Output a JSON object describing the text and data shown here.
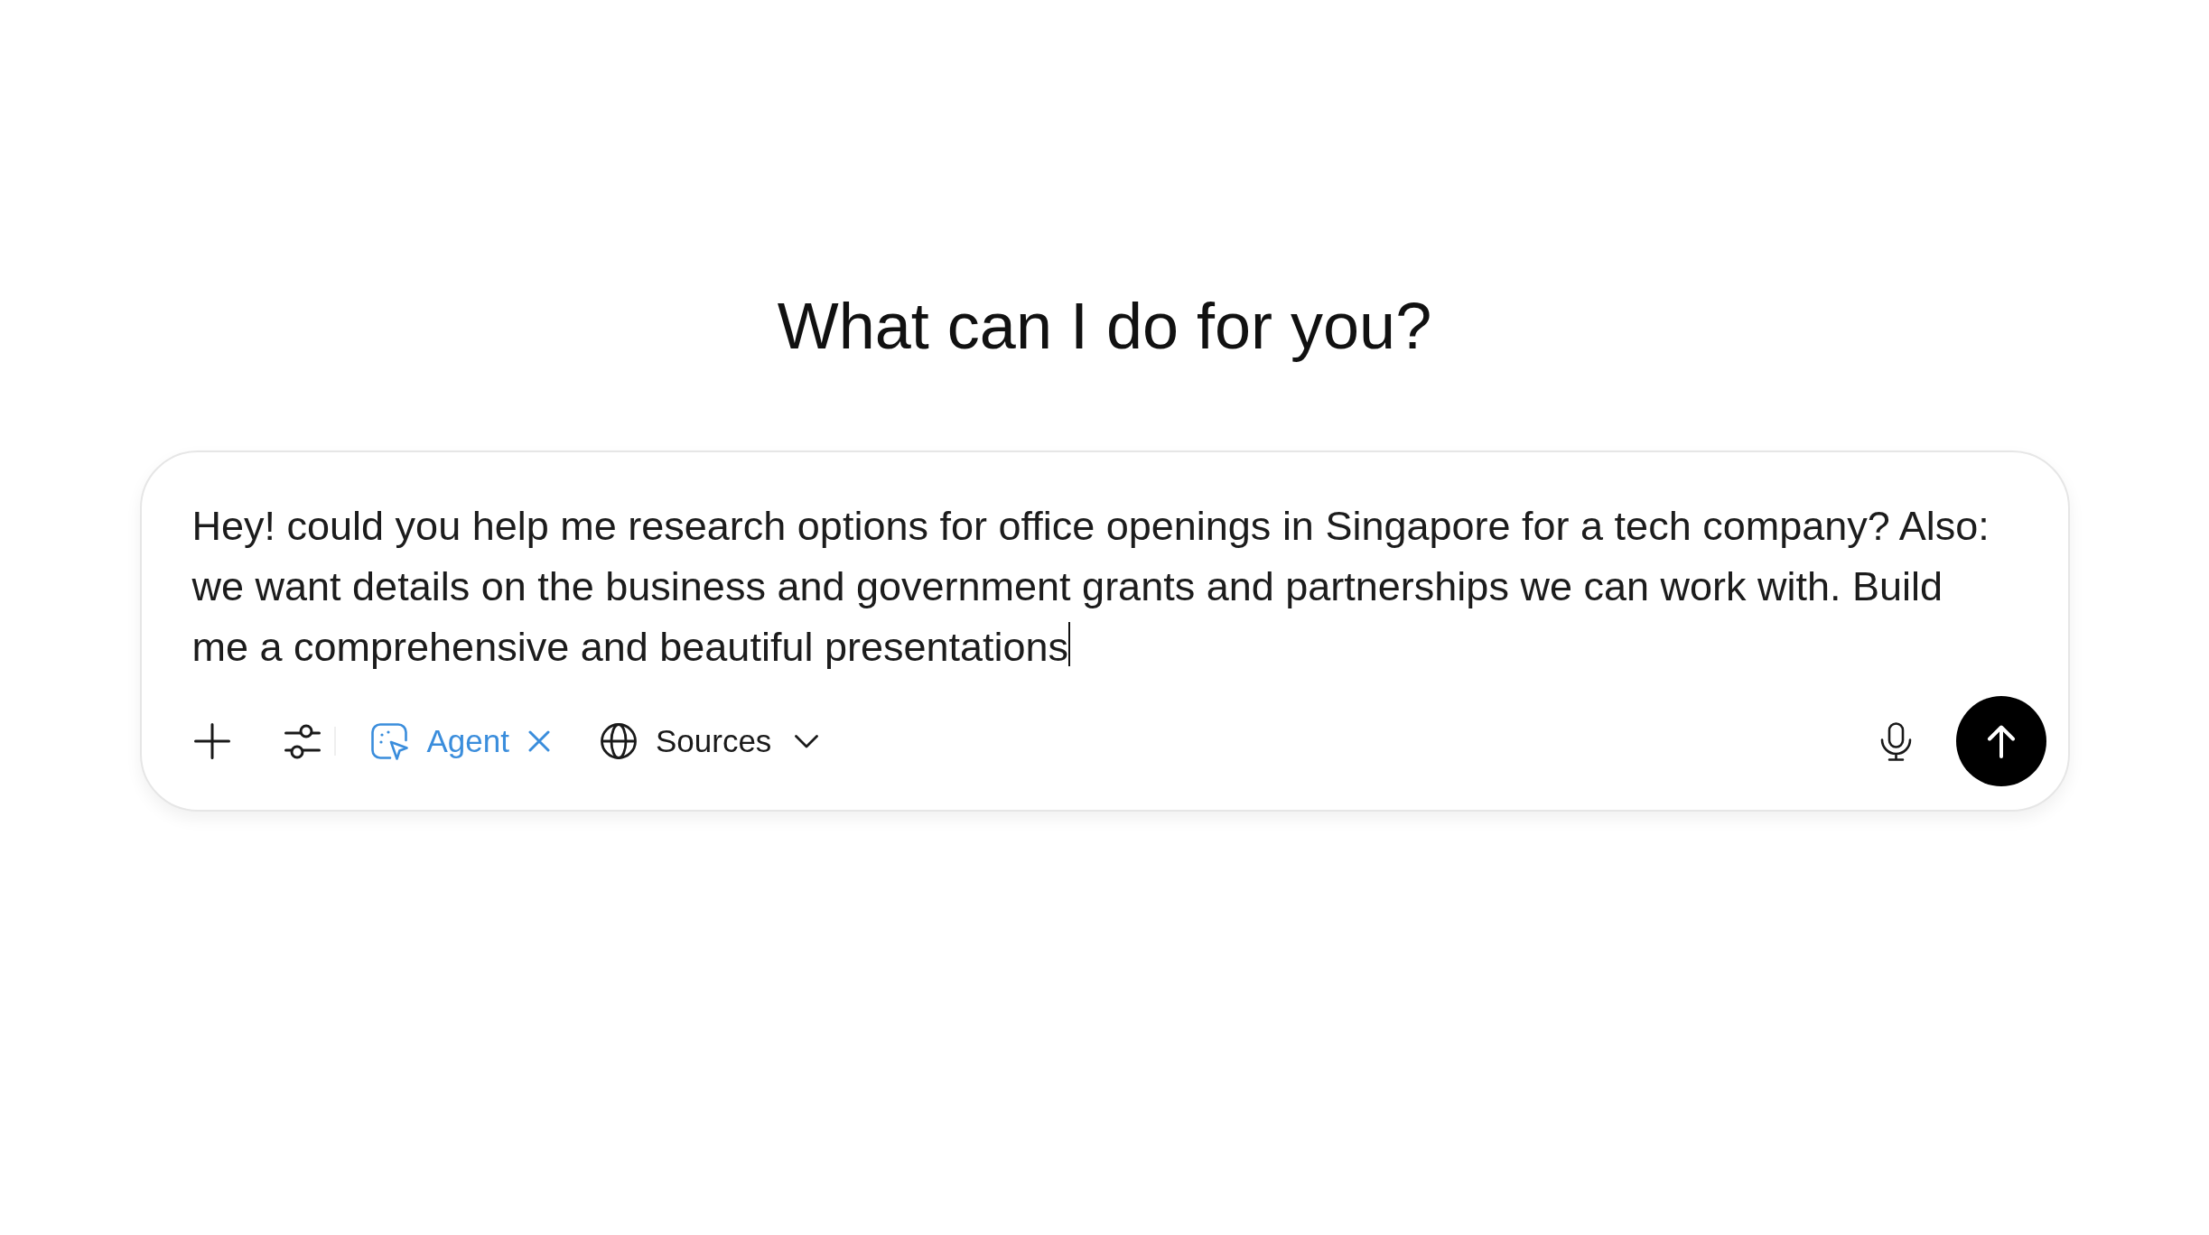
{
  "heading": "What can I do for you?",
  "composer": {
    "value": "Hey! could you help me research options for office openings in Singapore for a tech company? Also: we want details on the business and government grants and partnerships we can work with. Build me a comprehensive and beautiful presentations",
    "focused": true,
    "mode_chip": {
      "label": "Agent",
      "selected": true
    },
    "sources_menu": {
      "label": "Sources"
    }
  }
}
